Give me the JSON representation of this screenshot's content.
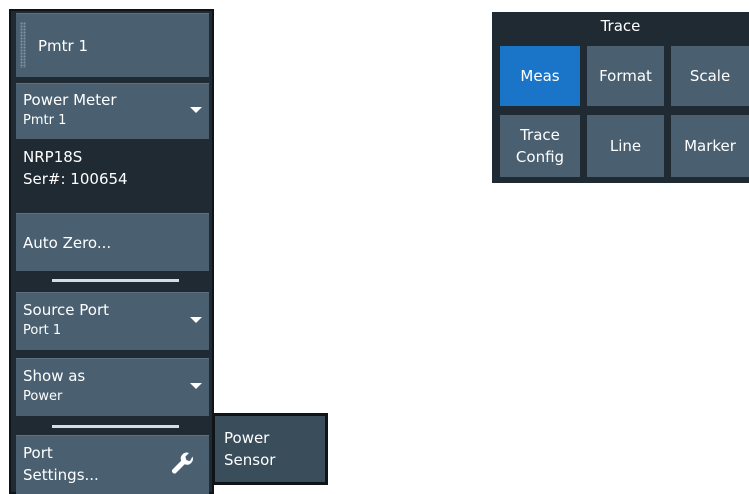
{
  "left_panel": {
    "pmtr_button": "Pmtr 1",
    "power_meter": {
      "label": "Power Meter",
      "value": "Pmtr 1"
    },
    "sensor_info": {
      "model": "NRP18S",
      "serial": "Ser#: 100654"
    },
    "auto_zero": "Auto Zero...",
    "source_port": {
      "label": "Source Port",
      "value": "Port 1"
    },
    "show_as": {
      "label": "Show as",
      "value": "Power"
    },
    "port_settings": {
      "line1": "Port",
      "line2": "Settings..."
    }
  },
  "popup": {
    "line1": "Power",
    "line2": "Sensor"
  },
  "trace_panel": {
    "title": "Trace",
    "buttons": [
      {
        "label": "Meas",
        "active": true
      },
      {
        "label": "Format"
      },
      {
        "label": "Scale"
      },
      {
        "line1": "Trace",
        "line2": "Config"
      },
      {
        "label": "Line"
      },
      {
        "label": "Marker"
      }
    ]
  },
  "colors": {
    "panel_bg": "#1f2a33",
    "button": "#4a6071",
    "active": "#1a75c9"
  },
  "icons": [
    "wrench-icon",
    "chevron-down-icon",
    "grip-icon"
  ]
}
